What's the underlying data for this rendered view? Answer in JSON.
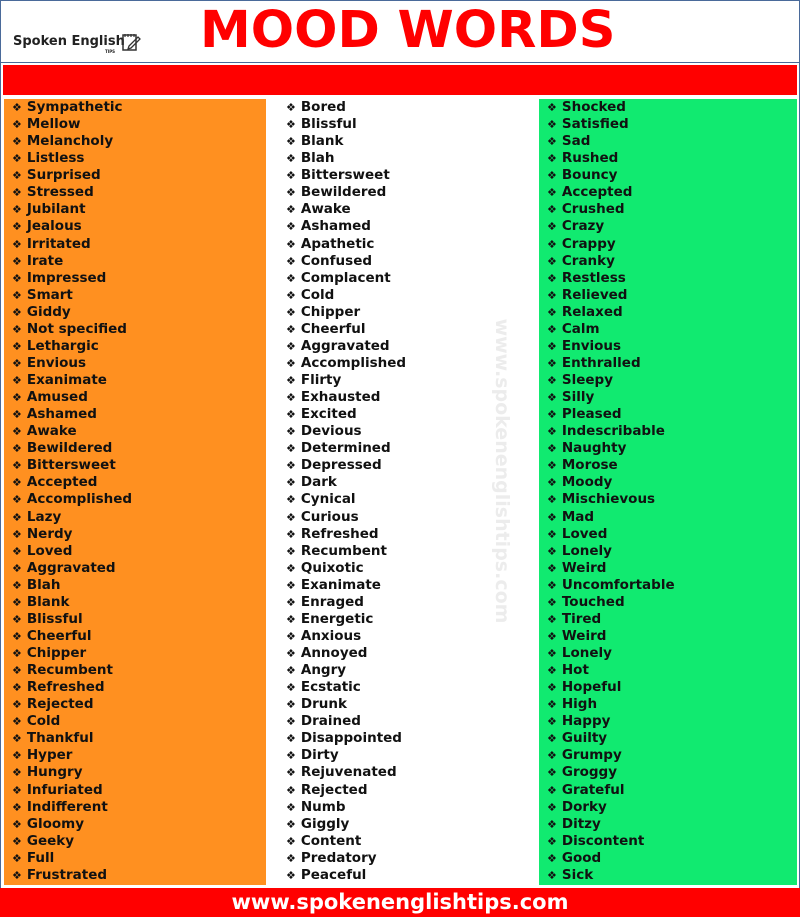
{
  "header": {
    "logo_text": "Spoken English",
    "logo_subtext": "TIPS",
    "title": "MOOD WORDS"
  },
  "colors": {
    "title": "#ff0000",
    "bar": "#ff0000",
    "col1": "#ff9020",
    "col2": "#ffffff",
    "col3": "#11ea70"
  },
  "bullet_icon": "four-diamond-bullet",
  "watermark": "www.spokenenglishtips.com",
  "columns": [
    [
      "Sympathetic",
      "Mellow",
      "Melancholy",
      "Listless",
      "Surprised",
      "Stressed",
      "Jubilant",
      "Jealous",
      "Irritated",
      "Irate",
      "Impressed",
      "Smart",
      "Giddy",
      "Not specified",
      "Lethargic",
      "Envious",
      "Exanimate",
      "Amused",
      "Ashamed",
      "Awake",
      "Bewildered",
      "Bittersweet",
      "Accepted",
      "Accomplished",
      "Lazy",
      "Nerdy",
      "Loved",
      "Aggravated",
      "Blah",
      "Blank",
      "Blissful",
      "Cheerful",
      "Chipper",
      "Recumbent",
      "Refreshed",
      "Rejected",
      "Cold",
      "Thankful",
      "Hyper",
      "Hungry",
      "Infuriated",
      "Indifferent",
      "Gloomy",
      "Geeky",
      "Full",
      "Frustrated"
    ],
    [
      "Bored",
      "Blissful",
      "Blank",
      "Blah",
      "Bittersweet",
      "Bewildered",
      "Awake",
      "Ashamed",
      "Apathetic",
      "Confused",
      "Complacent",
      "Cold",
      "Chipper",
      "Cheerful",
      "Aggravated",
      "Accomplished",
      "Flirty",
      "Exhausted",
      "Excited",
      "Devious",
      "Determined",
      "Depressed",
      "Dark",
      "Cynical",
      "Curious",
      "Refreshed",
      "Recumbent",
      "Quixotic",
      "Exanimate",
      "Enraged",
      "Energetic",
      "Anxious",
      "Annoyed",
      "Angry",
      "Ecstatic",
      "Drunk",
      "Drained",
      "Disappointed",
      "Dirty",
      "Rejuvenated",
      "Rejected",
      "Numb",
      "Giggly",
      "Content",
      "Predatory",
      "Peaceful"
    ],
    [
      "Shocked",
      "Satisfied",
      "Sad",
      "Rushed",
      "Bouncy",
      "Accepted",
      "Crushed",
      "Crazy",
      "Crappy",
      "Cranky",
      "Restless",
      "Relieved",
      "Relaxed",
      "Calm",
      "Envious",
      "Enthralled",
      "Sleepy",
      "Silly",
      "Pleased",
      "Indescribable",
      "Naughty",
      "Morose",
      "Moody",
      "Mischievous",
      "Mad",
      "Loved",
      "Lonely",
      "Weird",
      "Uncomfortable",
      "Touched",
      "Tired",
      "Weird",
      "Lonely",
      "Hot",
      "Hopeful",
      "High",
      "Happy",
      "Guilty",
      "Grumpy",
      "Groggy",
      "Grateful",
      "Dorky",
      "Ditzy",
      "Discontent",
      "Good",
      "Sick"
    ]
  ],
  "footer": {
    "url": "www.spokenenglishtips.com"
  }
}
